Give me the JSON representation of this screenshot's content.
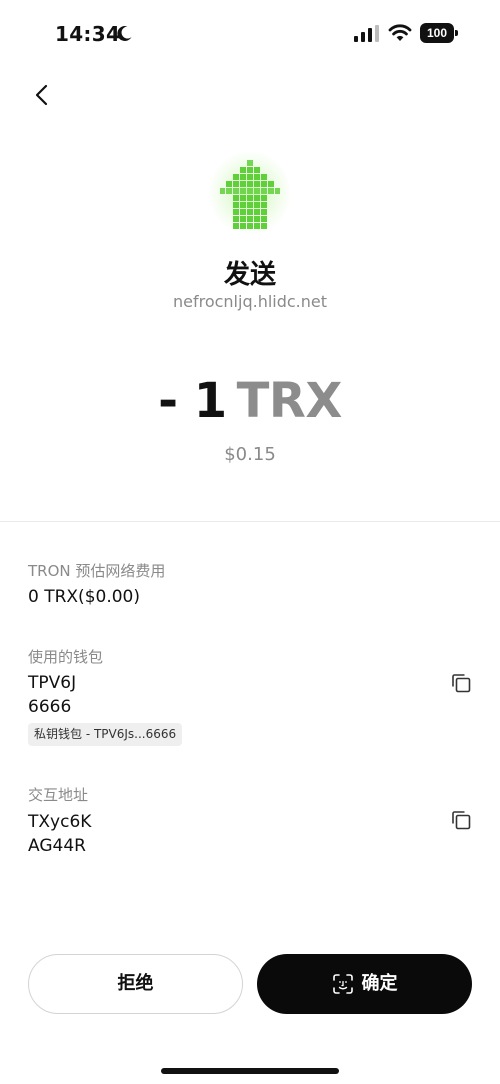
{
  "status_bar": {
    "time": "14:34",
    "battery": "100",
    "icons": [
      "moon-icon",
      "signal-icon",
      "wifi-icon",
      "battery-icon"
    ]
  },
  "nav": {
    "back_icon": "chevron-left-icon"
  },
  "transaction": {
    "icon": "send-arrow-icon",
    "title": "发送",
    "origin": "nefrocnljq.hlidc.net",
    "amount": "- 1",
    "unit": "TRX",
    "fiat": "$0.15"
  },
  "details": {
    "fee": {
      "label": "TRON 预估网络费用",
      "value": "0 TRX($0.00)"
    },
    "wallet": {
      "label": "使用的钱包",
      "line1": "TPV6J",
      "line2": "6666",
      "tag": "私钥钱包 - TPV6Js...6666"
    },
    "contract": {
      "label": "交互地址",
      "line1": "TXyc6K",
      "line2": "AG44R"
    }
  },
  "actions": {
    "reject": "拒绝",
    "confirm": "确定"
  },
  "colors": {
    "accent_green": "#5fcf3a",
    "primary_button": "#0a0a0a",
    "muted_text": "#8a8a8a"
  }
}
